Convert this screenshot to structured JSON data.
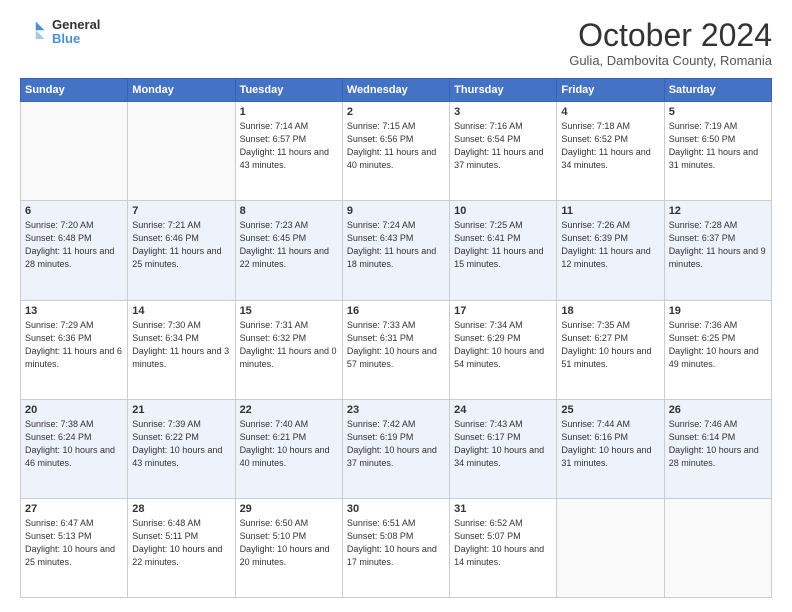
{
  "header": {
    "logo_general": "General",
    "logo_blue": "Blue",
    "month_title": "October 2024",
    "location": "Gulia, Dambovita County, Romania"
  },
  "weekdays": [
    "Sunday",
    "Monday",
    "Tuesday",
    "Wednesday",
    "Thursday",
    "Friday",
    "Saturday"
  ],
  "weeks": [
    [
      {
        "day": "",
        "info": ""
      },
      {
        "day": "",
        "info": ""
      },
      {
        "day": "1",
        "info": "Sunrise: 7:14 AM\nSunset: 6:57 PM\nDaylight: 11 hours and 43 minutes."
      },
      {
        "day": "2",
        "info": "Sunrise: 7:15 AM\nSunset: 6:56 PM\nDaylight: 11 hours and 40 minutes."
      },
      {
        "day": "3",
        "info": "Sunrise: 7:16 AM\nSunset: 6:54 PM\nDaylight: 11 hours and 37 minutes."
      },
      {
        "day": "4",
        "info": "Sunrise: 7:18 AM\nSunset: 6:52 PM\nDaylight: 11 hours and 34 minutes."
      },
      {
        "day": "5",
        "info": "Sunrise: 7:19 AM\nSunset: 6:50 PM\nDaylight: 11 hours and 31 minutes."
      }
    ],
    [
      {
        "day": "6",
        "info": "Sunrise: 7:20 AM\nSunset: 6:48 PM\nDaylight: 11 hours and 28 minutes."
      },
      {
        "day": "7",
        "info": "Sunrise: 7:21 AM\nSunset: 6:46 PM\nDaylight: 11 hours and 25 minutes."
      },
      {
        "day": "8",
        "info": "Sunrise: 7:23 AM\nSunset: 6:45 PM\nDaylight: 11 hours and 22 minutes."
      },
      {
        "day": "9",
        "info": "Sunrise: 7:24 AM\nSunset: 6:43 PM\nDaylight: 11 hours and 18 minutes."
      },
      {
        "day": "10",
        "info": "Sunrise: 7:25 AM\nSunset: 6:41 PM\nDaylight: 11 hours and 15 minutes."
      },
      {
        "day": "11",
        "info": "Sunrise: 7:26 AM\nSunset: 6:39 PM\nDaylight: 11 hours and 12 minutes."
      },
      {
        "day": "12",
        "info": "Sunrise: 7:28 AM\nSunset: 6:37 PM\nDaylight: 11 hours and 9 minutes."
      }
    ],
    [
      {
        "day": "13",
        "info": "Sunrise: 7:29 AM\nSunset: 6:36 PM\nDaylight: 11 hours and 6 minutes."
      },
      {
        "day": "14",
        "info": "Sunrise: 7:30 AM\nSunset: 6:34 PM\nDaylight: 11 hours and 3 minutes."
      },
      {
        "day": "15",
        "info": "Sunrise: 7:31 AM\nSunset: 6:32 PM\nDaylight: 11 hours and 0 minutes."
      },
      {
        "day": "16",
        "info": "Sunrise: 7:33 AM\nSunset: 6:31 PM\nDaylight: 10 hours and 57 minutes."
      },
      {
        "day": "17",
        "info": "Sunrise: 7:34 AM\nSunset: 6:29 PM\nDaylight: 10 hours and 54 minutes."
      },
      {
        "day": "18",
        "info": "Sunrise: 7:35 AM\nSunset: 6:27 PM\nDaylight: 10 hours and 51 minutes."
      },
      {
        "day": "19",
        "info": "Sunrise: 7:36 AM\nSunset: 6:25 PM\nDaylight: 10 hours and 49 minutes."
      }
    ],
    [
      {
        "day": "20",
        "info": "Sunrise: 7:38 AM\nSunset: 6:24 PM\nDaylight: 10 hours and 46 minutes."
      },
      {
        "day": "21",
        "info": "Sunrise: 7:39 AM\nSunset: 6:22 PM\nDaylight: 10 hours and 43 minutes."
      },
      {
        "day": "22",
        "info": "Sunrise: 7:40 AM\nSunset: 6:21 PM\nDaylight: 10 hours and 40 minutes."
      },
      {
        "day": "23",
        "info": "Sunrise: 7:42 AM\nSunset: 6:19 PM\nDaylight: 10 hours and 37 minutes."
      },
      {
        "day": "24",
        "info": "Sunrise: 7:43 AM\nSunset: 6:17 PM\nDaylight: 10 hours and 34 minutes."
      },
      {
        "day": "25",
        "info": "Sunrise: 7:44 AM\nSunset: 6:16 PM\nDaylight: 10 hours and 31 minutes."
      },
      {
        "day": "26",
        "info": "Sunrise: 7:46 AM\nSunset: 6:14 PM\nDaylight: 10 hours and 28 minutes."
      }
    ],
    [
      {
        "day": "27",
        "info": "Sunrise: 6:47 AM\nSunset: 5:13 PM\nDaylight: 10 hours and 25 minutes."
      },
      {
        "day": "28",
        "info": "Sunrise: 6:48 AM\nSunset: 5:11 PM\nDaylight: 10 hours and 22 minutes."
      },
      {
        "day": "29",
        "info": "Sunrise: 6:50 AM\nSunset: 5:10 PM\nDaylight: 10 hours and 20 minutes."
      },
      {
        "day": "30",
        "info": "Sunrise: 6:51 AM\nSunset: 5:08 PM\nDaylight: 10 hours and 17 minutes."
      },
      {
        "day": "31",
        "info": "Sunrise: 6:52 AM\nSunset: 5:07 PM\nDaylight: 10 hours and 14 minutes."
      },
      {
        "day": "",
        "info": ""
      },
      {
        "day": "",
        "info": ""
      }
    ]
  ]
}
